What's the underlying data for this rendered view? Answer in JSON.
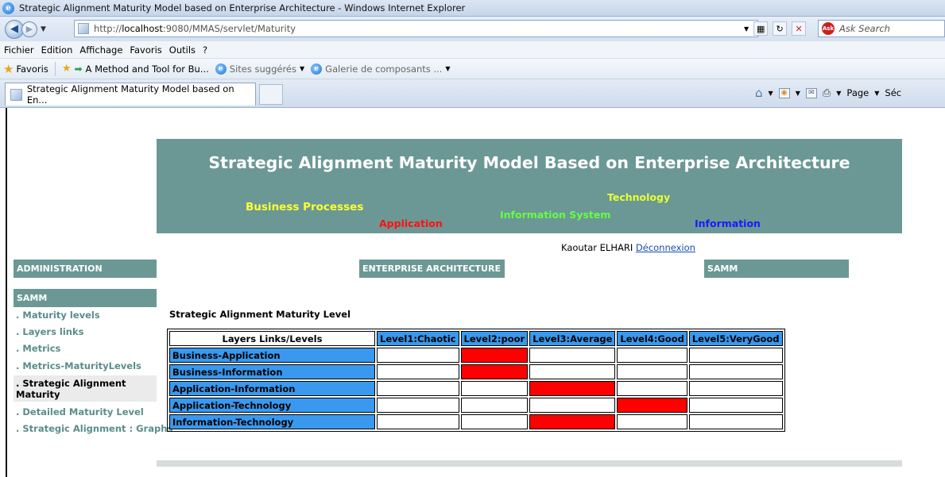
{
  "window": {
    "title": "Strategic Alignment Maturity Model based on Enterprise Architecture - Windows Internet Explorer"
  },
  "address": {
    "url_prefix": "http://",
    "url_host": "localhost",
    "url_rest": ":9080/MMAS/servlet/Maturity",
    "search_placeholder": "Ask Search"
  },
  "menu": [
    "Fichier",
    "Edition",
    "Affichage",
    "Favoris",
    "Outils",
    "?"
  ],
  "favorites_bar": {
    "favorites_label": "Favoris",
    "fav_item_1": "A Method and Tool for Bu...",
    "fav_item_2": "Sites suggérés",
    "fav_item_3": "Galerie de composants ..."
  },
  "tab": {
    "title": "Strategic Alignment Maturity Model based on En..."
  },
  "command_bar": {
    "page_label": "Page",
    "safety_label": "Séc"
  },
  "banner": {
    "title": "Strategic Alignment Maturity Model Based on Enterprise Architecture",
    "business_processes": "Business Processes",
    "application": "Application",
    "information_system": "Information System",
    "technology": "Technology",
    "information": "Information",
    "colors": {
      "background": "#6b9895",
      "business_processes": "#ffff33",
      "application": "#ff1111",
      "information_system": "#66ff44",
      "technology": "#e8ff33",
      "information": "#1919ff"
    }
  },
  "user": {
    "name": "Kaoutar ELHARI",
    "logout": "Déconnexion"
  },
  "nav": {
    "administration": "ADMINISTRATION",
    "enterprise_architecture": "ENTERPRISE ARCHITECTURE",
    "samm_top": "SAMM",
    "samm_side": "SAMM"
  },
  "sidebar": {
    "items": [
      ". Maturity levels",
      ". Layers links",
      ". Metrics",
      ". Metrics-MaturityLevels",
      ". Strategic Alignment Maturity",
      ". Detailed Maturity Level",
      ". Strategic Alignment : Graphs"
    ],
    "active_index": 4
  },
  "content": {
    "section_title": "Strategic Alignment Maturity Level",
    "table": {
      "corner_header": "Layers Links/Levels",
      "levels": [
        "Level1:Chaotic",
        "Level2:poor",
        "Level3:Average",
        "Level4:Good",
        "Level5:VeryGood"
      ],
      "rows": [
        {
          "link": "Business-Application",
          "level_index": 1
        },
        {
          "link": "Business-Information",
          "level_index": 1
        },
        {
          "link": "Application-Information",
          "level_index": 2
        },
        {
          "link": "Application-Technology",
          "level_index": 3
        },
        {
          "link": "Information-Technology",
          "level_index": 2
        }
      ],
      "colors": {
        "header_bg": "#3a99ee",
        "active_cell": "#ff0000"
      }
    }
  }
}
